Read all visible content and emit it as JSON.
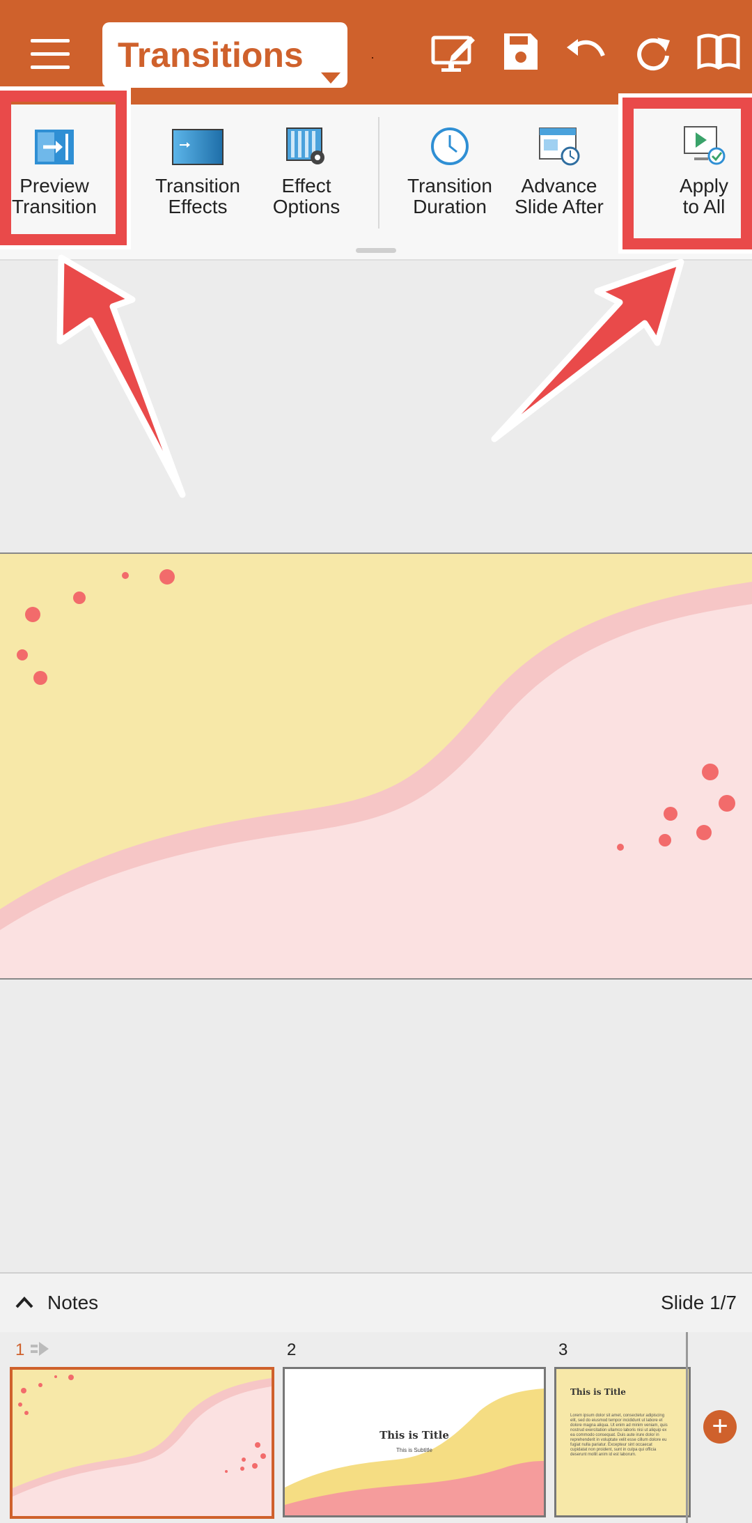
{
  "toolbar": {
    "tab_label": "Transitions",
    "icons": [
      "menu-icon",
      "edit-presentation-icon",
      "save-icon",
      "undo-icon",
      "redo-icon",
      "book-icon"
    ]
  },
  "ribbon": {
    "items": [
      {
        "label": "Preview\nTransition",
        "icon": "preview-transition-icon"
      },
      {
        "label": "Transition\nEffects",
        "icon": "transition-effects-icon"
      },
      {
        "label": "Effect\nOptions",
        "icon": "effect-options-icon"
      },
      {
        "label": "Transition\nDuration",
        "icon": "clock-icon"
      },
      {
        "label": "Advance\nSlide After",
        "icon": "advance-slide-icon"
      },
      {
        "label": "Apply\nto All",
        "icon": "apply-to-all-icon"
      }
    ]
  },
  "notes": {
    "label": "Notes",
    "slide_counter": "Slide 1/7"
  },
  "thumbnails": [
    {
      "number": "1",
      "title": "",
      "subtitle": ""
    },
    {
      "number": "2",
      "title": "This is Title",
      "subtitle": "This is Subtitle"
    },
    {
      "number": "3",
      "title": "This is Title",
      "body": "Lorem ipsum dolor sit amet, consectetur adipiscing elit, sed do eiusmod tempor incididunt ut labore et dolore magna aliqua. Ut enim ad minim veniam, quis nostrud exercitation ullamco laboris nisi ut aliquip ex ea commodo consequat. Duis aute irure dolor in reprehenderit in voluptate velit esse cillum dolore eu fugiat nulla pariatur. Excepteur sint occaecat cupidatat non proident, sunt in culpa qui officia deserunt mollit anim id est laborum."
    }
  ],
  "colors": {
    "accent": "#cf612c",
    "highlight": "#e94a4a",
    "slide_yellow": "#f7e8a8",
    "slide_pink": "#fbe1e1",
    "slide_pink_band": "#f6c6c6",
    "dots": "#f26b6b"
  }
}
